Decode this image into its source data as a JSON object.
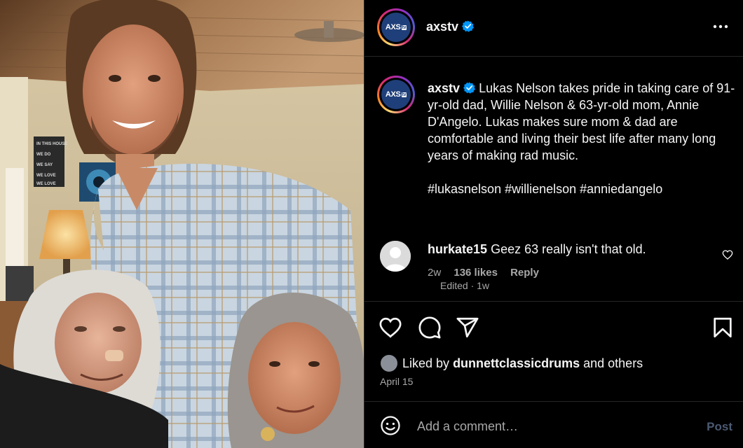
{
  "post": {
    "username": "axstv",
    "logo_text": "AXS",
    "logo_badge": "tv",
    "caption": "Lukas Nelson takes pride in taking care of 91-yr-old dad, Willie Nelson & 63-yr-old mom, Annie D'Angelo. Lukas makes sure mom & dad are comfortable and living their best life after many long years of making rad music.",
    "hashtags": "#lukasnelson #willienelson #anniedangelo",
    "edited_label": "Edited · 1w",
    "more_icon": "more-horizontal-icon",
    "verified_icon": "verified-badge-icon"
  },
  "comment": {
    "username": "hurkate15",
    "text": "Geez 63 really isn't that old.",
    "age": "2w",
    "likes": "136 likes",
    "reply": "Reply"
  },
  "engagement": {
    "liked_by_prefix": "Liked by",
    "liked_by_user": "dunnettclassicdrums",
    "liked_by_suffix": "and others",
    "date": "April 15"
  },
  "add_comment": {
    "placeholder": "Add a comment…",
    "post_label": "Post"
  },
  "colors": {
    "background": "#000000",
    "text": "#f5f5f5",
    "muted": "#a8a8a8",
    "verified": "#0095f6",
    "post_disabled": "#4c5a73",
    "logo_blue": "#1f3f7a"
  }
}
